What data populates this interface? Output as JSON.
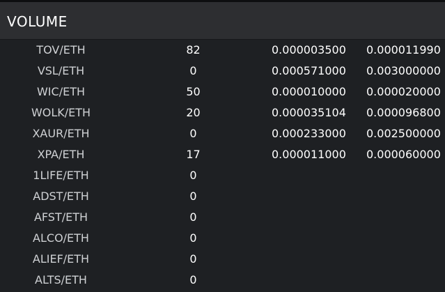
{
  "header": {
    "title": "VOLUME"
  },
  "rows": [
    {
      "pair": "TOV/ETH",
      "volume": "82",
      "bid": "0.000003500",
      "ask": "0.000011990"
    },
    {
      "pair": "VSL/ETH",
      "volume": "0",
      "bid": "0.000571000",
      "ask": "0.003000000"
    },
    {
      "pair": "WIC/ETH",
      "volume": "50",
      "bid": "0.000010000",
      "ask": "0.000020000"
    },
    {
      "pair": "WOLK/ETH",
      "volume": "20",
      "bid": "0.000035104",
      "ask": "0.000096800"
    },
    {
      "pair": "XAUR/ETH",
      "volume": "0",
      "bid": "0.000233000",
      "ask": "0.002500000"
    },
    {
      "pair": "XPA/ETH",
      "volume": "17",
      "bid": "0.000011000",
      "ask": "0.000060000"
    },
    {
      "pair": "1LIFE/ETH",
      "volume": "0",
      "bid": "",
      "ask": ""
    },
    {
      "pair": "ADST/ETH",
      "volume": "0",
      "bid": "",
      "ask": ""
    },
    {
      "pair": "AFST/ETH",
      "volume": "0",
      "bid": "",
      "ask": ""
    },
    {
      "pair": "ALCO/ETH",
      "volume": "0",
      "bid": "",
      "ask": ""
    },
    {
      "pair": "ALIEF/ETH",
      "volume": "0",
      "bid": "",
      "ask": ""
    },
    {
      "pair": "ALTS/ETH",
      "volume": "0",
      "bid": "",
      "ask": ""
    }
  ]
}
